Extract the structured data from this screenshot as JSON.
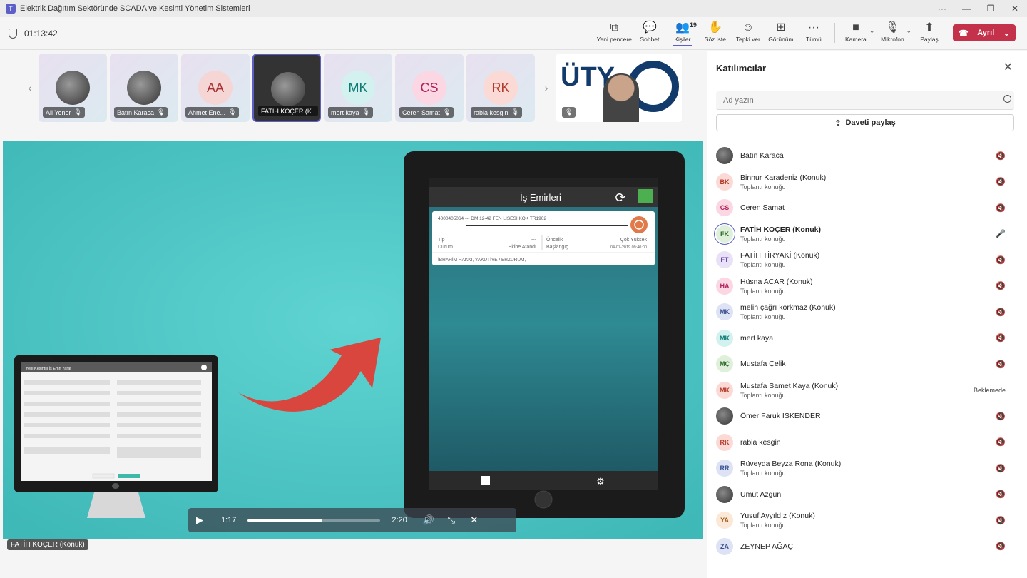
{
  "window": {
    "title": "Elektrik Dağıtım Sektöründe SCADA ve Kesinti Yönetim Sistemleri"
  },
  "meeting": {
    "timer": "01:13:42"
  },
  "toolbar": {
    "items": [
      {
        "label": "Yeni pencere",
        "icon": "popout-icon"
      },
      {
        "label": "Sohbet",
        "icon": "chat-icon"
      },
      {
        "label": "Kişiler",
        "icon": "people-icon",
        "badge": "19",
        "active": true
      },
      {
        "label": "Söz iste",
        "icon": "raise-hand-icon"
      },
      {
        "label": "Tepki ver",
        "icon": "emoji-icon"
      },
      {
        "label": "Görünüm",
        "icon": "grid-icon"
      },
      {
        "label": "Tümü",
        "icon": "more-icon"
      }
    ],
    "camera_label": "Kamera",
    "mic_label": "Mikrofon",
    "share_label": "Paylaş",
    "leave_label": "Ayrıl"
  },
  "strip": {
    "tiles": [
      {
        "name": "Ali Yener",
        "initials": "",
        "photo": true
      },
      {
        "name": "Batın Karaca",
        "initials": "",
        "photo": true
      },
      {
        "name": "Ahmet Ene...",
        "initials": "AA",
        "bg": "#f6d5d5",
        "fg": "#a33"
      },
      {
        "name": "FATİH KOÇER (K...",
        "initials": "",
        "photo": true,
        "active": true
      },
      {
        "name": "mert kaya",
        "initials": "MK",
        "bg": "#d2f1ef",
        "fg": "#0e7a74"
      },
      {
        "name": "Ceren Samat",
        "initials": "CS",
        "bg": "#fbd6e3",
        "fg": "#b0245a"
      },
      {
        "name": "rabia kesgin",
        "initials": "RK",
        "bg": "#fbdad6",
        "fg": "#b33a2a"
      }
    ],
    "logo_text": "ÜTY"
  },
  "stage": {
    "presenter_label": "FATİH KOÇER (Konuk)",
    "tablet": {
      "header": "İş Emirleri",
      "order_no": "4000405064 --- DM 12-42 FEN LISESI KÖK TR1902",
      "tip_label": "Tip",
      "tip_value": "---",
      "durum_label": "Durum",
      "durum_value": "Ekibe Atandı",
      "oncelik_label": "Öncelik",
      "oncelik_value": "Çok Yüksek",
      "baslangic_label": "Başlangıç",
      "baslangic_value": "04-07-2019 09:40:00",
      "address": "İBRAHİM HAKKI, YAKUTİYE / ERZURUM,"
    },
    "monitor_title": "Yeni Kesintili İş Emri Yarat"
  },
  "player": {
    "current": "1:17",
    "duration": "2:20",
    "progress": 0.56
  },
  "panel": {
    "title": "Katılımcılar",
    "search_placeholder": "Ad yazın",
    "invite_label": "Daveti paylaş",
    "participants": [
      {
        "name": "Batın Karaca",
        "sub": "",
        "initials": "",
        "photo": true,
        "status": "mic-off"
      },
      {
        "name": "Binnur Karadeniz (Konuk)",
        "sub": "Toplantı konuğu",
        "initials": "BK",
        "bg": "#fbdad6",
        "fg": "#b33a2a",
        "status": "mic-off"
      },
      {
        "name": "Ceren Samat",
        "sub": "",
        "initials": "CS",
        "bg": "#fbd6e3",
        "fg": "#b0245a",
        "status": "mic-off"
      },
      {
        "name": "FATİH KOÇER (Konuk)",
        "sub": "Toplantı konuğu",
        "initials": "FK",
        "bg": "#dff0da",
        "fg": "#2d6a2a",
        "status": "mic-on",
        "bold": true,
        "ring": true
      },
      {
        "name": "FATİH TİRYAKİ (Konuk)",
        "sub": "Toplantı konuğu",
        "initials": "FT",
        "bg": "#e8e1f7",
        "fg": "#5b3a9b",
        "status": "mic-off"
      },
      {
        "name": "Hüsna ACAR (Konuk)",
        "sub": "Toplantı konuğu",
        "initials": "HA",
        "bg": "#fbd6e3",
        "fg": "#b0245a",
        "status": "mic-off"
      },
      {
        "name": "melih çağrı korkmaz (Konuk)",
        "sub": "Toplantı konuğu",
        "initials": "MK",
        "bg": "#dde3f5",
        "fg": "#3a4f8f",
        "status": "mic-off"
      },
      {
        "name": "mert kaya",
        "sub": "",
        "initials": "MK",
        "bg": "#d2f1ef",
        "fg": "#0e7a74",
        "status": "mic-off"
      },
      {
        "name": "Mustafa Çelik",
        "sub": "",
        "initials": "MÇ",
        "bg": "#dff0da",
        "fg": "#2d6a2a",
        "status": "mic-off"
      },
      {
        "name": "Mustafa Samet Kaya (Konuk)",
        "sub": "Toplantı konuğu",
        "initials": "MK",
        "bg": "#fbdad6",
        "fg": "#b33a2a",
        "status": "text",
        "status_text": "Beklemede"
      },
      {
        "name": "Ömer Faruk İSKENDER",
        "sub": "",
        "initials": "",
        "photo": true,
        "status": "mic-off"
      },
      {
        "name": "rabia kesgin",
        "sub": "",
        "initials": "RK",
        "bg": "#fbdad6",
        "fg": "#b33a2a",
        "status": "mic-off"
      },
      {
        "name": "Rüveyda Beyza Rona (Konuk)",
        "sub": "Toplantı konuğu",
        "initials": "RR",
        "bg": "#dde3f5",
        "fg": "#3a4f8f",
        "status": "mic-off"
      },
      {
        "name": "Umut Azgun",
        "sub": "",
        "initials": "",
        "photo": true,
        "status": "mic-off"
      },
      {
        "name": "Yusuf Ayyıldız (Konuk)",
        "sub": "Toplantı konuğu",
        "initials": "YA",
        "bg": "#fbe8d6",
        "fg": "#a05a1a",
        "status": "mic-off"
      },
      {
        "name": "ZEYNEP AĞAÇ",
        "sub": "",
        "initials": "ZA",
        "bg": "#dde3f5",
        "fg": "#3a4f8f",
        "status": "mic-off"
      }
    ]
  }
}
